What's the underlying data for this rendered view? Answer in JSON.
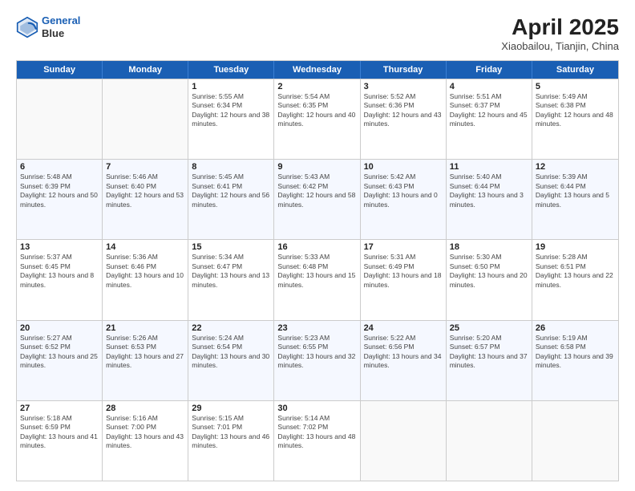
{
  "header": {
    "logo_line1": "General",
    "logo_line2": "Blue",
    "month": "April 2025",
    "location": "Xiaobailou, Tianjin, China"
  },
  "weekdays": [
    "Sunday",
    "Monday",
    "Tuesday",
    "Wednesday",
    "Thursday",
    "Friday",
    "Saturday"
  ],
  "rows": [
    [
      {
        "day": "",
        "info": ""
      },
      {
        "day": "",
        "info": ""
      },
      {
        "day": "1",
        "info": "Sunrise: 5:55 AM\nSunset: 6:34 PM\nDaylight: 12 hours and 38 minutes."
      },
      {
        "day": "2",
        "info": "Sunrise: 5:54 AM\nSunset: 6:35 PM\nDaylight: 12 hours and 40 minutes."
      },
      {
        "day": "3",
        "info": "Sunrise: 5:52 AM\nSunset: 6:36 PM\nDaylight: 12 hours and 43 minutes."
      },
      {
        "day": "4",
        "info": "Sunrise: 5:51 AM\nSunset: 6:37 PM\nDaylight: 12 hours and 45 minutes."
      },
      {
        "day": "5",
        "info": "Sunrise: 5:49 AM\nSunset: 6:38 PM\nDaylight: 12 hours and 48 minutes."
      }
    ],
    [
      {
        "day": "6",
        "info": "Sunrise: 5:48 AM\nSunset: 6:39 PM\nDaylight: 12 hours and 50 minutes."
      },
      {
        "day": "7",
        "info": "Sunrise: 5:46 AM\nSunset: 6:40 PM\nDaylight: 12 hours and 53 minutes."
      },
      {
        "day": "8",
        "info": "Sunrise: 5:45 AM\nSunset: 6:41 PM\nDaylight: 12 hours and 56 minutes."
      },
      {
        "day": "9",
        "info": "Sunrise: 5:43 AM\nSunset: 6:42 PM\nDaylight: 12 hours and 58 minutes."
      },
      {
        "day": "10",
        "info": "Sunrise: 5:42 AM\nSunset: 6:43 PM\nDaylight: 13 hours and 0 minutes."
      },
      {
        "day": "11",
        "info": "Sunrise: 5:40 AM\nSunset: 6:44 PM\nDaylight: 13 hours and 3 minutes."
      },
      {
        "day": "12",
        "info": "Sunrise: 5:39 AM\nSunset: 6:44 PM\nDaylight: 13 hours and 5 minutes."
      }
    ],
    [
      {
        "day": "13",
        "info": "Sunrise: 5:37 AM\nSunset: 6:45 PM\nDaylight: 13 hours and 8 minutes."
      },
      {
        "day": "14",
        "info": "Sunrise: 5:36 AM\nSunset: 6:46 PM\nDaylight: 13 hours and 10 minutes."
      },
      {
        "day": "15",
        "info": "Sunrise: 5:34 AM\nSunset: 6:47 PM\nDaylight: 13 hours and 13 minutes."
      },
      {
        "day": "16",
        "info": "Sunrise: 5:33 AM\nSunset: 6:48 PM\nDaylight: 13 hours and 15 minutes."
      },
      {
        "day": "17",
        "info": "Sunrise: 5:31 AM\nSunset: 6:49 PM\nDaylight: 13 hours and 18 minutes."
      },
      {
        "day": "18",
        "info": "Sunrise: 5:30 AM\nSunset: 6:50 PM\nDaylight: 13 hours and 20 minutes."
      },
      {
        "day": "19",
        "info": "Sunrise: 5:28 AM\nSunset: 6:51 PM\nDaylight: 13 hours and 22 minutes."
      }
    ],
    [
      {
        "day": "20",
        "info": "Sunrise: 5:27 AM\nSunset: 6:52 PM\nDaylight: 13 hours and 25 minutes."
      },
      {
        "day": "21",
        "info": "Sunrise: 5:26 AM\nSunset: 6:53 PM\nDaylight: 13 hours and 27 minutes."
      },
      {
        "day": "22",
        "info": "Sunrise: 5:24 AM\nSunset: 6:54 PM\nDaylight: 13 hours and 30 minutes."
      },
      {
        "day": "23",
        "info": "Sunrise: 5:23 AM\nSunset: 6:55 PM\nDaylight: 13 hours and 32 minutes."
      },
      {
        "day": "24",
        "info": "Sunrise: 5:22 AM\nSunset: 6:56 PM\nDaylight: 13 hours and 34 minutes."
      },
      {
        "day": "25",
        "info": "Sunrise: 5:20 AM\nSunset: 6:57 PM\nDaylight: 13 hours and 37 minutes."
      },
      {
        "day": "26",
        "info": "Sunrise: 5:19 AM\nSunset: 6:58 PM\nDaylight: 13 hours and 39 minutes."
      }
    ],
    [
      {
        "day": "27",
        "info": "Sunrise: 5:18 AM\nSunset: 6:59 PM\nDaylight: 13 hours and 41 minutes."
      },
      {
        "day": "28",
        "info": "Sunrise: 5:16 AM\nSunset: 7:00 PM\nDaylight: 13 hours and 43 minutes."
      },
      {
        "day": "29",
        "info": "Sunrise: 5:15 AM\nSunset: 7:01 PM\nDaylight: 13 hours and 46 minutes."
      },
      {
        "day": "30",
        "info": "Sunrise: 5:14 AM\nSunset: 7:02 PM\nDaylight: 13 hours and 48 minutes."
      },
      {
        "day": "",
        "info": ""
      },
      {
        "day": "",
        "info": ""
      },
      {
        "day": "",
        "info": ""
      }
    ]
  ]
}
